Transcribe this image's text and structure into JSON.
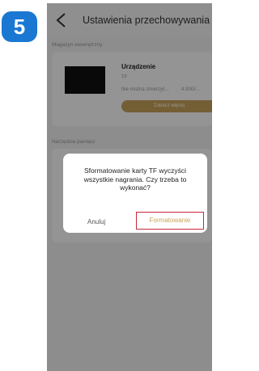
{
  "step_badge": "5",
  "header": {
    "title": "Ustawienia przechowywania"
  },
  "sections": {
    "storage_label": "Magazyn wewnętrzny",
    "tools_label": "Narzędzia pamięci"
  },
  "device": {
    "name": "Urządzenie",
    "type": "TF",
    "status": "Nie można zmierzyć...",
    "capacity": "4.00G/...",
    "detail_button": "Zobacz więcej"
  },
  "dialog": {
    "message": "Sformatowanie karty TF wyczyści wszystkie nagrania. Czy trzeba to wykonać?",
    "cancel_label": "Anuluj",
    "confirm_label": "Formatowanie"
  },
  "colors": {
    "badge": "#1a78d2",
    "accent_gold": "#c9a25a",
    "highlight_red": "#c8283a"
  }
}
